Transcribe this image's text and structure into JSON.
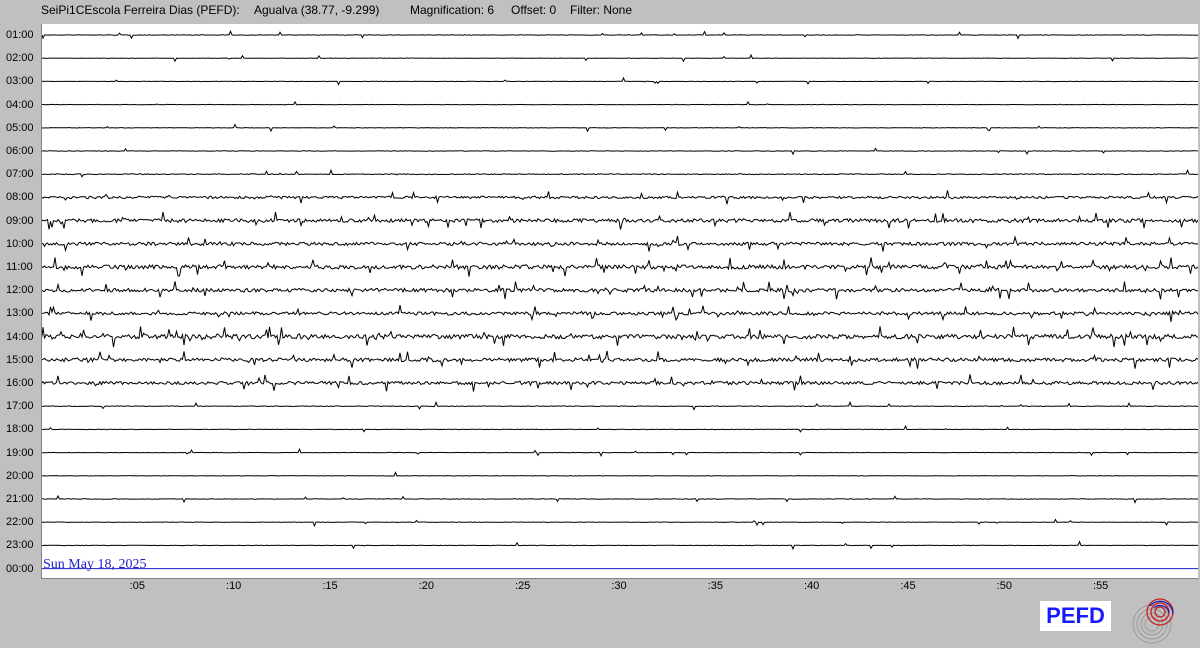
{
  "header": {
    "station": "SeiPi1CEscola Ferreira Dias (PEFD):",
    "location": "Agualva (38.77, -9.299)",
    "magnification": "Magnification: 6",
    "offset": "Offset: 0",
    "filter": "Filter: None"
  },
  "hour_labels": [
    "01:00",
    "02:00",
    "03:00",
    "04:00",
    "05:00",
    "06:00",
    "07:00",
    "08:00",
    "09:00",
    "10:00",
    "11:00",
    "12:00",
    "13:00",
    "14:00",
    "15:00",
    "16:00",
    "17:00",
    "18:00",
    "19:00",
    "20:00",
    "21:00",
    "22:00",
    "23:00",
    "00:00"
  ],
  "minute_labels": [
    ":05",
    ":10",
    ":15",
    ":20",
    ":25",
    ":30",
    ":35",
    ":40",
    ":45",
    ":50",
    ":55"
  ],
  "activity_levels": [
    0.05,
    0.05,
    0.04,
    0.05,
    0.06,
    0.06,
    0.1,
    0.3,
    0.45,
    0.4,
    0.5,
    0.45,
    0.4,
    0.55,
    0.45,
    0.4,
    0.08,
    0.06,
    0.05,
    0.05,
    0.06,
    0.06,
    0.06,
    0
  ],
  "date_label": "Sun May 18, 2025",
  "logo_text": "PEFD",
  "colors": {
    "trace": "#000000",
    "current_line": "#1e1ec8",
    "date": "#1e1ec8",
    "logo": "#1a1aff"
  }
}
